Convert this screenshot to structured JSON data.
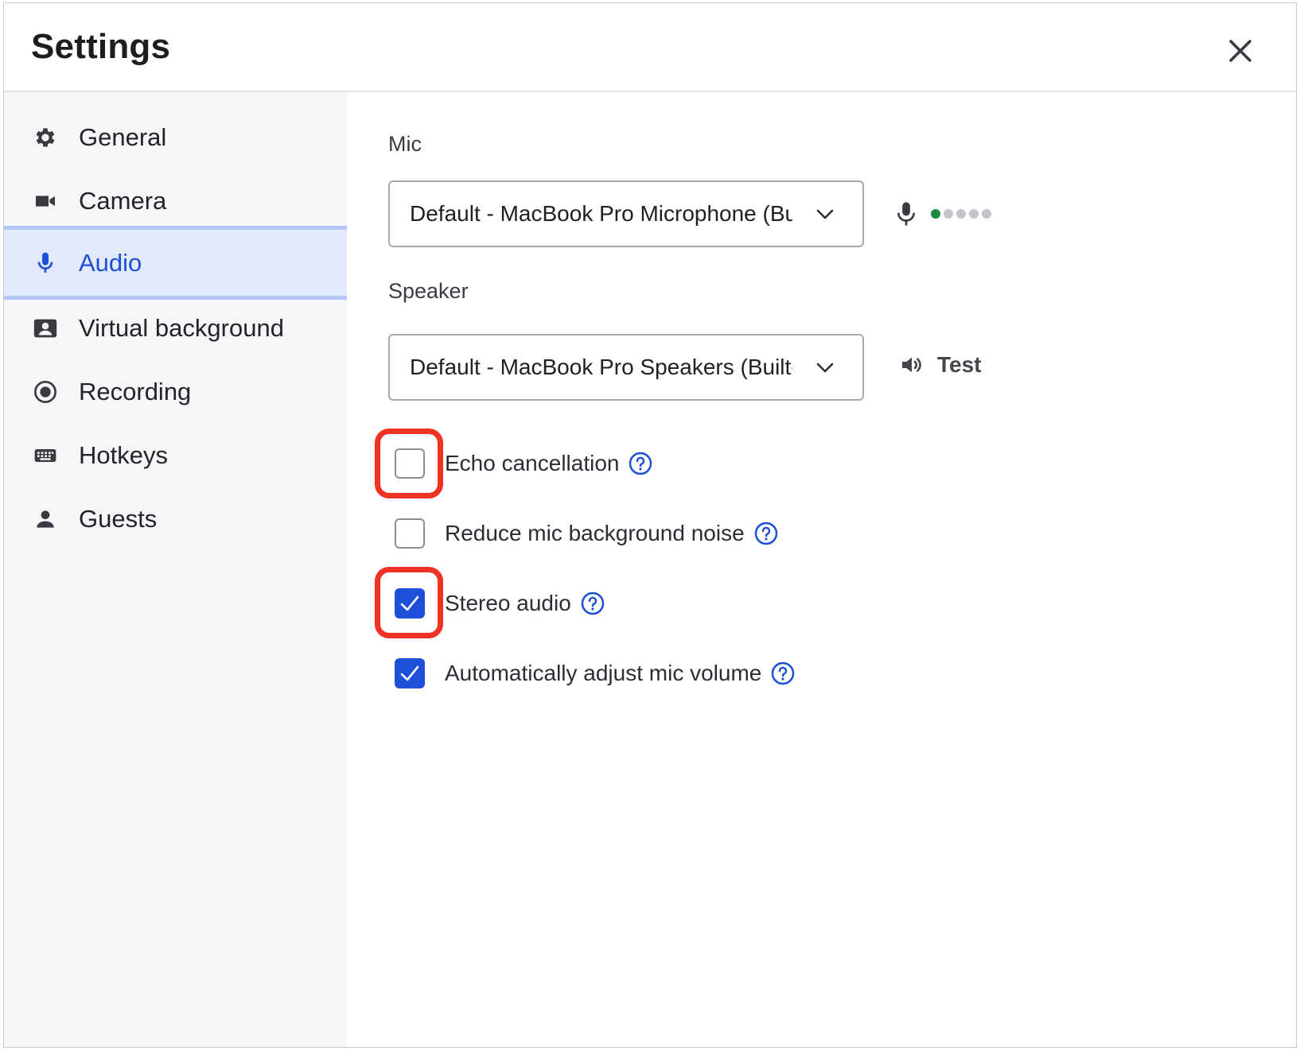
{
  "dialog": {
    "title": "Settings"
  },
  "sidebar": {
    "items": [
      {
        "label": "General",
        "icon": "gear-icon",
        "active": false
      },
      {
        "label": "Camera",
        "icon": "video-camera-icon",
        "active": false
      },
      {
        "label": "Audio",
        "icon": "microphone-icon",
        "active": true
      },
      {
        "label": "Virtual background",
        "icon": "portrait-icon",
        "active": false
      },
      {
        "label": "Recording",
        "icon": "record-icon",
        "active": false
      },
      {
        "label": "Hotkeys",
        "icon": "keyboard-icon",
        "active": false
      },
      {
        "label": "Guests",
        "icon": "person-icon",
        "active": false
      }
    ]
  },
  "audio": {
    "mic": {
      "label": "Mic",
      "value": "Default - MacBook Pro Microphone (Built-in)",
      "level_active_dots": 1,
      "level_total_dots": 5
    },
    "speaker": {
      "label": "Speaker",
      "value": "Default - MacBook Pro Speakers (Built-in)",
      "test_label": "Test"
    },
    "options": [
      {
        "label": "Echo cancellation",
        "checked": false,
        "highlighted": true
      },
      {
        "label": "Reduce mic background noise",
        "checked": false,
        "highlighted": false
      },
      {
        "label": "Stereo audio",
        "checked": true,
        "highlighted": true
      },
      {
        "label": "Automatically adjust mic volume",
        "checked": true,
        "highlighted": false
      }
    ]
  },
  "colors": {
    "accent": "#1d4fd8",
    "active_bg": "#e2e9fb",
    "highlight": "#f03224",
    "level_on": "#1e8a3c"
  }
}
